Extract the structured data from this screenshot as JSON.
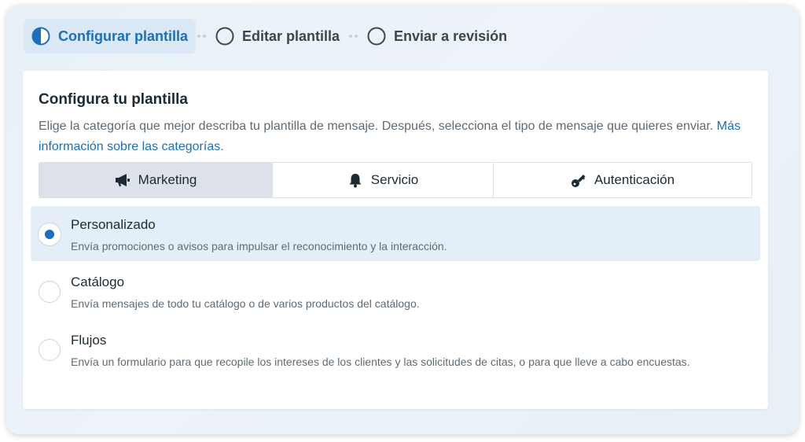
{
  "stepper": {
    "steps": [
      {
        "label": "Configurar plantilla",
        "state": "active"
      },
      {
        "label": "Editar plantilla",
        "state": "pending"
      },
      {
        "label": "Enviar a revisión",
        "state": "pending"
      }
    ]
  },
  "card": {
    "title": "Configura tu plantilla",
    "description": "Elige la categoría que mejor describa tu plantilla de mensaje. Después, selecciona el tipo de mensaje que quieres enviar.",
    "link": "Más información sobre las categorías",
    "link_suffix": "."
  },
  "tabs": [
    {
      "label": "Marketing",
      "icon": "megaphone-icon",
      "selected": true
    },
    {
      "label": "Servicio",
      "icon": "bell-icon",
      "selected": false
    },
    {
      "label": "Autenticación",
      "icon": "key-icon",
      "selected": false
    }
  ],
  "options": [
    {
      "title": "Personalizado",
      "subtitle": "Envía promociones o avisos para impulsar el reconocimiento y la interacción.",
      "selected": true
    },
    {
      "title": "Catálogo",
      "subtitle": "Envía mensajes de todo tu catálogo o de varios productos del catálogo.",
      "selected": false
    },
    {
      "title": "Flujos",
      "subtitle": "Envía un formulario para que recopile los intereses de los clientes y las solicitudes de citas, o para que lleve a cabo encuestas.",
      "selected": false
    }
  ],
  "colors": {
    "accent": "#1b6fbf",
    "selected_bg": "#e3eef8",
    "tab_selected_bg": "#dce1ea"
  }
}
